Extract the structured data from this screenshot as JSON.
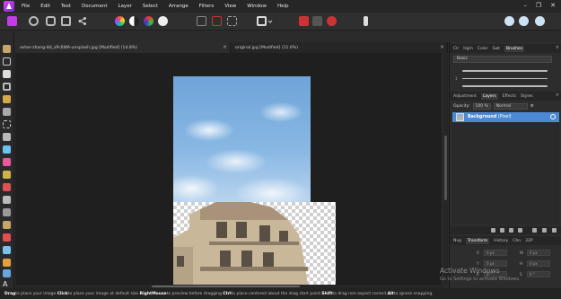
{
  "menubar": {
    "items": [
      "File",
      "Edit",
      "Text",
      "Document",
      "Layer",
      "Select",
      "Arrange",
      "Filters",
      "View",
      "Window",
      "Help"
    ],
    "window_controls": [
      "–",
      "❐",
      "✕"
    ]
  },
  "doc_tabs": [
    {
      "label": "asher-zhang-8d_sPc6WA-unsplash.jpg [Modified] (14.8%)"
    },
    {
      "label": "original.jpg [Modified] (11.6%)"
    }
  ],
  "right_panel": {
    "top_tabs": [
      "Clr",
      "Hgm",
      "Color",
      "Swt",
      "Brushes"
    ],
    "brush_category": "Basic",
    "brush_sizes": [
      "",
      "1",
      "",
      ""
    ],
    "layer_tabs": [
      "Adjustment",
      "Layers",
      "Effects",
      "Styles"
    ],
    "opacity_label": "Opacity:",
    "opacity_value": "100 %",
    "blend_mode": "Normal",
    "layer_name": "Background",
    "layer_suffix": "(Pixel)",
    "transform_tabs": [
      "Nvg",
      "Transform",
      "History",
      "Chn",
      "32P"
    ],
    "transform_fields": [
      "0 px",
      "0 px",
      "0 px",
      "0 px",
      "0 °",
      "0 °"
    ],
    "transform_labels": [
      "X",
      "Y",
      "W",
      "H",
      "R",
      "S"
    ]
  },
  "watermark": {
    "line1": "Activate Windows",
    "line2": "Go to Settings to activate Windows."
  },
  "statusbar": {
    "parts": [
      {
        "b": "Drag",
        "t": " to place your image. "
      },
      {
        "b": "Click",
        "t": " to place your image at default size. "
      },
      {
        "b": "RightMouse",
        "t": " to preview before dragging. "
      },
      {
        "b": "Ctrl",
        "t": " to place centered about the drag start point. "
      },
      {
        "b": "Shift",
        "t": " to drag non-aspect correct. "
      },
      {
        "b": "Alt",
        "t": " to ignore snapping."
      }
    ]
  },
  "colors": {
    "accent": "#4c89d4",
    "app_logo": "#c13ee6",
    "background": "#2b2b2b"
  }
}
